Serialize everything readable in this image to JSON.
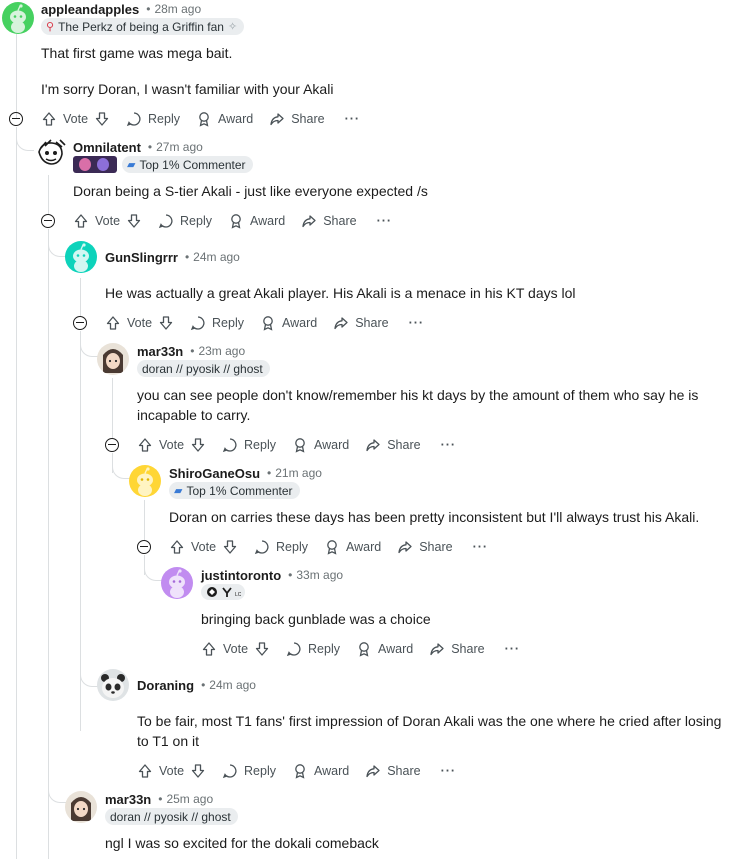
{
  "actions": {
    "vote": "Vote",
    "reply": "Reply",
    "award": "Award",
    "share": "Share",
    "more": "···"
  },
  "comments": [
    {
      "username": "appleandapples",
      "time": "28m ago",
      "flair": "The Perkz of being a Griffin fan",
      "lines": [
        "That first game was mega bait.",
        "I'm sorry Doran, I wasn't familiar with your Akali"
      ]
    },
    {
      "username": "Omnilatent",
      "time": "27m ago",
      "flair": "Top 1% Commenter",
      "lines": [
        "Doran being a S-tier Akali - just like everyone expected /s"
      ]
    },
    {
      "username": "GunSlingrrr",
      "time": "24m ago",
      "lines": [
        "He was actually a great Akali player. His Akali is a menace in his KT days lol"
      ]
    },
    {
      "username": "mar33n",
      "time": "23m ago",
      "flair": "doran // pyosik // ghost",
      "lines": [
        "you can see people don't know/remember his kt days by the amount of them who say he is",
        "incapable to carry."
      ]
    },
    {
      "username": "ShiroGaneOsu",
      "time": "21m ago",
      "flair": "Top 1% Commenter",
      "lines": [
        "Doran on carries these days has been pretty inconsistent but I'll always trust his Akali."
      ]
    },
    {
      "username": "justintoronto",
      "time": "33m ago",
      "lines": [
        "bringing back gunblade was a choice"
      ]
    },
    {
      "username": "Doraning",
      "time": "24m ago",
      "lines": [
        "To be fair, most T1 fans' first impression of Doran Akali was the one where he cried after losing",
        "to T1 on it"
      ]
    },
    {
      "username": "mar33n",
      "time": "25m ago",
      "flair": "doran // pyosik // ghost",
      "lines": [
        "ngl I was so excited for the dokali comeback"
      ]
    }
  ],
  "colors": {
    "avatar_green": "#46d160",
    "avatar_teal": "#0dd3bb",
    "avatar_yellow": "#ffd635",
    "avatar_purple": "#c18cf0",
    "flair_bg": "#eaedef"
  }
}
